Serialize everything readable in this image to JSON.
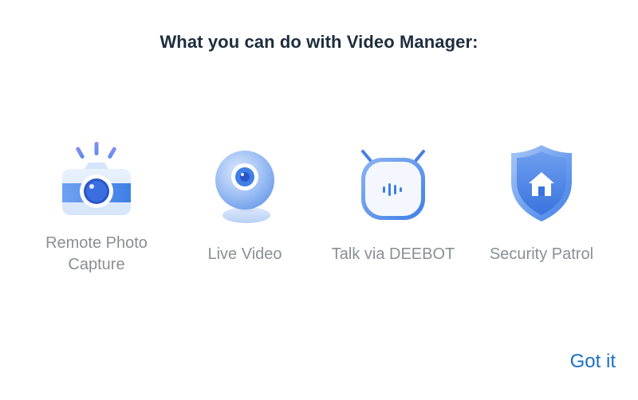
{
  "title": "What you can do with Video Manager:",
  "features": [
    {
      "label_lines": [
        "Remote Photo",
        "Capture"
      ],
      "icon": "camera-icon"
    },
    {
      "label_lines": [
        "Live Video"
      ],
      "icon": "webcam-icon"
    },
    {
      "label_lines": [
        "Talk via DEEBOT"
      ],
      "icon": "robot-voice-icon"
    },
    {
      "label_lines": [
        "Security Patrol"
      ],
      "icon": "shield-home-icon"
    }
  ],
  "got_it_label": "Got it",
  "colors": {
    "title": "#1f2d3d",
    "label": "#8a8f95",
    "accent": "#1a6fc4",
    "icon_blue": "#3f7fe6",
    "icon_light": "#cfe0fb"
  }
}
